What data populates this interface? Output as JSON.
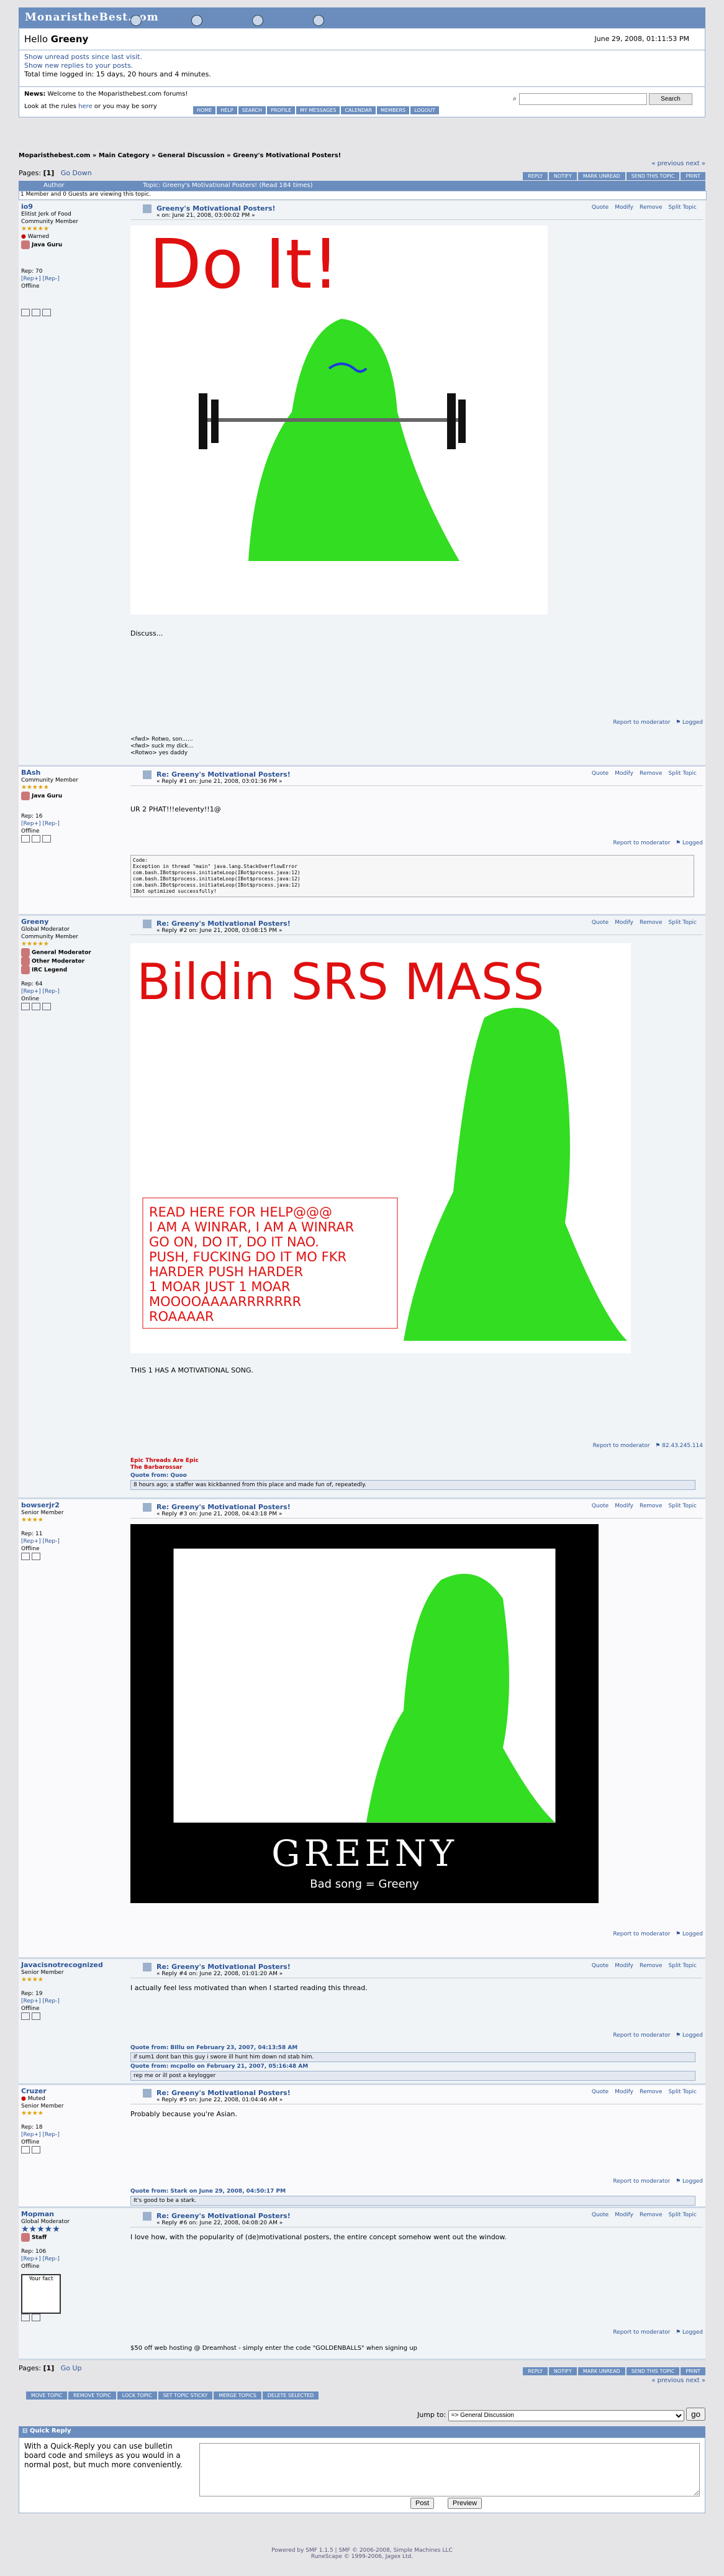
{
  "logo": "MonaristheBest.com",
  "hello": {
    "greeting": "Hello ",
    "user": "Greeny",
    "date": "June 29, 2008, 01:11:53 PM"
  },
  "info": {
    "unread": "Show unread posts since last visit.",
    "replies": "Show new replies to your posts.",
    "logged": "Total time logged in:  15 days, 20 hours and 4 minutes."
  },
  "news": {
    "label": "News:",
    "text": "Welcome to the Moparisthebest.com forums!",
    "rules": "Look at the rules ",
    "here": "here",
    "rules2": " or you may be sorry"
  },
  "search": {
    "button": "Search"
  },
  "menu": [
    "HOME",
    "HELP",
    "SEARCH",
    "PROFILE",
    "MY MESSAGES",
    "CALENDAR",
    "MEMBERS",
    "LOGOUT"
  ],
  "breadcrumb": "Moparisthebest.com » Main Category » General Discussion » Greeny's Motivational Posters!",
  "prevnext": "« previous next »",
  "pages": {
    "label": "Pages: ",
    "num": "[1]",
    "go": "Go Down",
    "go_up": "Go Up"
  },
  "topic_buttons": [
    "REPLY",
    "NOTIFY",
    "MARK UNREAD",
    "SEND THIS TOPIC",
    "PRINT"
  ],
  "thead": {
    "author": "Author",
    "topic": "Topic: Greeny's Motivational Posters!  (Read 184 times)"
  },
  "viewing": "1 Member and 0 Guests are viewing this topic.",
  "tools": [
    "Quote",
    "Modify",
    "Remove",
    "Split Topic"
  ],
  "report": "Report to moderator",
  "logged": "Logged",
  "posts": [
    {
      "name": "io9",
      "title": "Elitist Jerk of Food",
      "group": "Community Member",
      "extra": "Warned",
      "badge": "Java Guru",
      "rep": "Rep: 70",
      "repl": "[Rep+] [Rep-]",
      "status": "Offline",
      "ptitle": "Greeny's Motivational Posters!",
      "pdate": "« on: June 21, 2008, 03:00:02 PM »",
      "text": "Discuss...",
      "img": "Do It!",
      "sig": [
        "<fwd> Rotwo, son......",
        "<fwd> suck my dick...",
        "<Rotwo> yes daddy"
      ]
    },
    {
      "name": "BAsh",
      "title": "Community Member",
      "badge": "Java Guru",
      "rep": "Rep: 16",
      "repl": "[Rep+] [Rep-]",
      "status": "Offline",
      "ptitle": "Re: Greeny's Motivational Posters!",
      "pdate": "« Reply #1 on: June 21, 2008, 03:01:36 PM »",
      "text": "UR 2 PHAT!!!eleventy!!1@",
      "code": [
        "Code:",
        "Exception in thread \"main\" java.lang.StackOverflowError",
        "        com.bash.IBot$process.initiateLoop(IBot$process.java:12)",
        "        com.bash.IBot$process.initiateLoop(IBot$process.java:12)",
        "        com.bash.IBot$process.initiateLoop(IBot$process.java:12)",
        "IBot optimized successfully!"
      ]
    },
    {
      "name": "Greeny",
      "title": "Global Moderator",
      "group": "Community Member",
      "badge": "General Moderator",
      "badge2": "Other Moderator",
      "badge3": "IRC Legend",
      "rep": "Rep: 64",
      "repl": "[Rep+] [Rep-]",
      "status": "Online",
      "ptitle": "Re: Greeny's Motivational Posters!",
      "pdate": "« Reply #2 on: June 21, 2008, 03:08:15 PM »",
      "text": "THIS 1 HAS A MOTIVATIONAL SONG.",
      "ip": "82.43.245.114",
      "img": "Bildin SRS MASS",
      "imgtext": [
        "READ HERE FOR HELP@@@",
        "I AM A WINRAR, I AM A WINRAR",
        "GO ON, DO IT, DO IT NAO.",
        "PUSH, FUCKING DO IT MO FKR",
        "HARDER PUSH HARDER",
        "1 MOAR JUST 1 MOAR",
        "MOOOOAAAARRRRRRR",
        "ROAAAAR"
      ],
      "sig": [
        "Epic Threads Are Epic",
        "The Barbarossar"
      ],
      "quotehead": "Quote from: Quoo",
      "quote": "8 hours ago; a staffer was kickbanned from this place and made fun of, repeatedly."
    },
    {
      "name": "bowserjr2",
      "title": "Senior Member",
      "rep": "Rep: 11",
      "repl": "[Rep+] [Rep-]",
      "status": "Offline",
      "ptitle": "Re: Greeny's Motivational Posters!",
      "pdate": "« Reply #3 on: June 21, 2008, 04:43:18 PM »",
      "poster": "GREENY",
      "caption": "Bad song = Greeny"
    },
    {
      "name": "Javacisnotrecognized",
      "title": "Senior Member",
      "rep": "Rep: 19",
      "repl": "[Rep+] [Rep-]",
      "status": "Offline",
      "ptitle": "Re: Greeny's Motivational Posters!",
      "pdate": "« Reply #4 on: June 22, 2008, 01:01:20 AM »",
      "text": "I actually feel less motivated than when I started reading this thread.",
      "q1h": "Quote from: BIllu on February 23, 2007, 04:13:58 AM",
      "q1": "if sum1 dont ban this guy i swore ill hunt him down nd stab him.",
      "q2h": "Quote from: mcpollo  on February 21, 2007, 05:16:48 AM",
      "q2": "rep me or ill post a keylogger"
    },
    {
      "name": "Cruzer",
      "extra": "Muted",
      "title": "Senior Member",
      "rep": "Rep: 18",
      "repl": "[Rep+] [Rep-]",
      "status": "Offline",
      "ptitle": "Re: Greeny's Motivational Posters!",
      "pdate": "« Reply #5 on: June 22, 2008, 01:04:46 AM »",
      "text": "Probably because you're Asian.",
      "qh": "Quote from: Stark on June 29, 2008, 04:50:17 PM",
      "q": "It's good to be a stark."
    },
    {
      "name": "Mopman",
      "title": "Global Moderator",
      "rep": "Rep: 106",
      "repl": "[Rep+] [Rep-]",
      "status": "Offline",
      "badge": "Staff",
      "ptitle": "Re: Greeny's Motivational Posters!",
      "pdate": "« Reply #6 on: June 22, 2008, 04:08:20 AM »",
      "text": "I love how, with the popularity of (de)motivational posters, the entire concept somehow went out the window.",
      "sigtext": "$50 off web hosting @ Dreamhost - simply enter the code \"GOLDENBALLS\" when signing up",
      "avtext": "Your fact"
    }
  ],
  "mod_buttons": [
    "MOVE TOPIC",
    "REMOVE TOPIC",
    "LOCK TOPIC",
    "SET TOPIC STICKY",
    "MERGE TOPICS",
    "DELETE SELECTED"
  ],
  "jump": {
    "label": "Jump to:",
    "value": "=> General Discussion",
    "go": "go"
  },
  "quickreply": {
    "title": "Quick Reply",
    "desc": "With a Quick-Reply you can use bulletin board code and smileys as you would in a normal post, but much more conveniently.",
    "post": "Post",
    "preview": "Preview"
  },
  "footer": [
    "Powered by SMF 1.1.5 | SMF © 2006-2008, Simple Machines LLC",
    "RuneScape © 1999-2006, Jagex Ltd."
  ]
}
